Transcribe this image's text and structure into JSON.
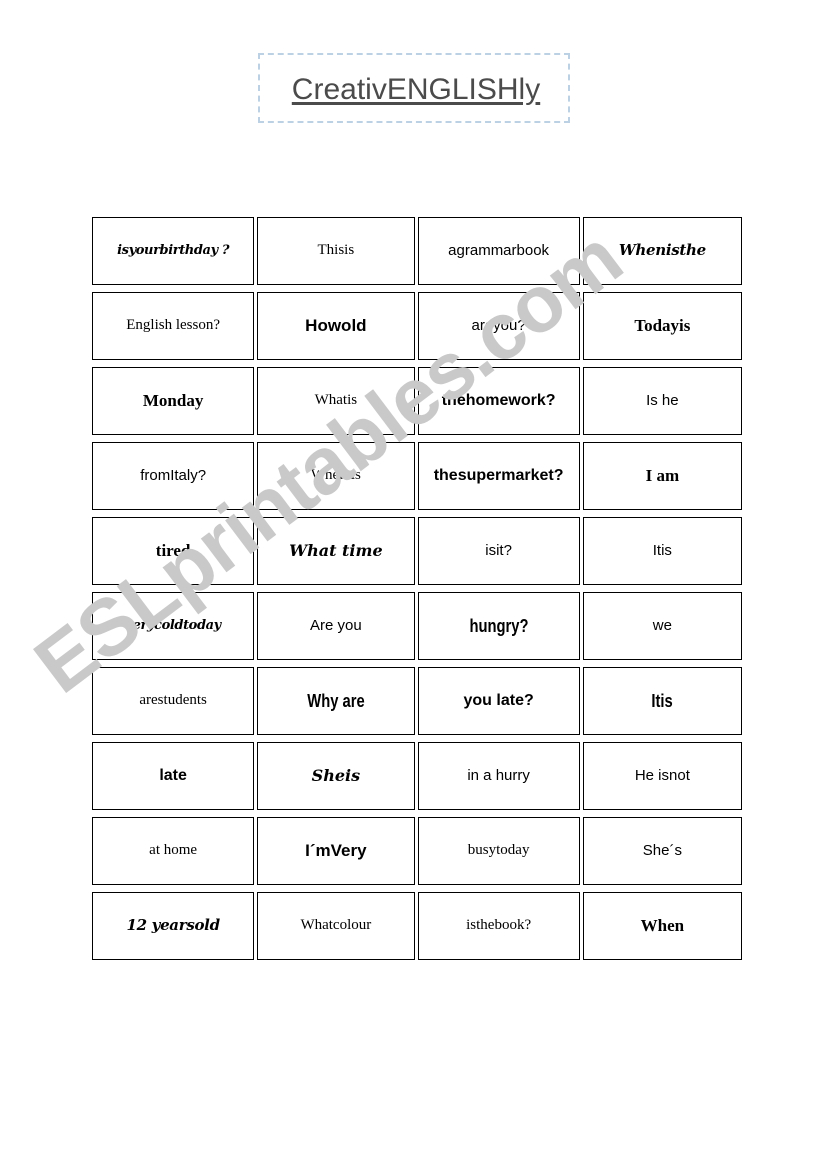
{
  "page": {
    "title": "CreativENGLISHly",
    "watermark": "ESLprintables.com",
    "watermark_color": "#c9c9c9",
    "title_box_border_color": "#bcd2e4",
    "background": "#ffffff"
  },
  "cards": {
    "columns": 4,
    "rows": 10,
    "cells": [
      [
        {
          "text": "isyourbirthday ?"
        },
        {
          "text": "Thisis"
        },
        {
          "text": "agrammarbook"
        },
        {
          "text": "Whenisthe"
        }
      ],
      [
        {
          "text": "English lesson?"
        },
        {
          "text": "Howold"
        },
        {
          "text": "areyou?"
        },
        {
          "text": "Todayis"
        }
      ],
      [
        {
          "text": "Monday"
        },
        {
          "text": "Whatis"
        },
        {
          "text": "thehomework?"
        },
        {
          "text": "Is he"
        }
      ],
      [
        {
          "text": "fromItaly?"
        },
        {
          "text": "Whereis"
        },
        {
          "text": "thesupermarket?"
        },
        {
          "text": "I am"
        }
      ],
      [
        {
          "text": "tired"
        },
        {
          "text": "What time"
        },
        {
          "text": "isit?"
        },
        {
          "text": "Itis"
        }
      ],
      [
        {
          "text": "verycoldtoday"
        },
        {
          "text": "Are you"
        },
        {
          "text": "hungry?"
        },
        {
          "text": "we"
        }
      ],
      [
        {
          "text": "arestudents"
        },
        {
          "text": "Why are"
        },
        {
          "text": "you late?"
        },
        {
          "text": "Itis"
        }
      ],
      [
        {
          "text": "late"
        },
        {
          "text": "Sheis"
        },
        {
          "text": "in a hurry"
        },
        {
          "text": "He isnot"
        }
      ],
      [
        {
          "text": "at home"
        },
        {
          "text": "I´mVery"
        },
        {
          "text": "busytoday"
        },
        {
          "text": "She´s"
        }
      ],
      [
        {
          "text": "12 yearsold"
        },
        {
          "text": "Whatcolour"
        },
        {
          "text": "isthebook?"
        },
        {
          "text": "When"
        }
      ]
    ]
  }
}
